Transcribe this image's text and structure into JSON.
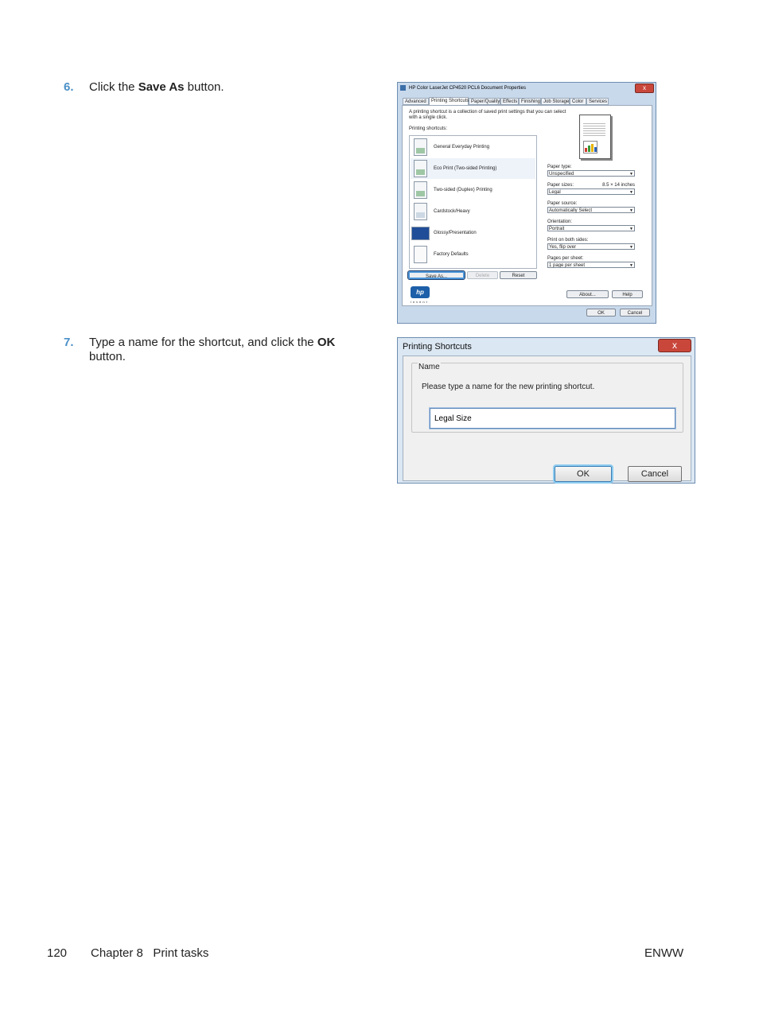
{
  "steps": [
    {
      "num": "6.",
      "pre": "Click the ",
      "bold": "Save As",
      "post": " button.",
      "line2": ""
    },
    {
      "num": "7.",
      "pre": "Type a name for the shortcut, and click the ",
      "bold": "OK",
      "post": "",
      "line2": "button."
    }
  ],
  "dialog1": {
    "title": "HP Color LaserJet CP4520 PCL6 Document Properties",
    "close": "x",
    "tabs": [
      "Advanced",
      "Printing Shortcuts",
      "Paper/Quality",
      "Effects",
      "Finishing",
      "Job Storage",
      "Color",
      "Services"
    ],
    "active_tab": "Printing Shortcuts",
    "description": "A printing shortcut is a collection of saved print settings that you can select with a single click.",
    "shortcuts_label": "Printing shortcuts:",
    "shortcuts": [
      "General Everyday Printing",
      "Eco Print (Two-sided Printing)",
      "Two-sided (Duplex) Printing",
      "Cardstock/Heavy",
      "Glossy/Presentation",
      "Factory Defaults"
    ],
    "selected_shortcut": "Eco Print (Two-sided Printing)",
    "buttons": {
      "save_as": "Save As...",
      "delete": "Delete",
      "reset": "Reset",
      "about": "About...",
      "help": "Help",
      "ok": "OK",
      "cancel": "Cancel"
    },
    "fields": {
      "paper_type_label": "Paper type:",
      "paper_type": "Unspecified",
      "paper_sizes_label": "Paper sizes:",
      "paper_sizes_dim": "8.5 × 14 inches",
      "paper_size": "Legal",
      "paper_source_label": "Paper source:",
      "paper_source": "Automatically Select",
      "orientation_label": "Orientation:",
      "orientation": "Portrait",
      "both_sides_label": "Print on both sides:",
      "both_sides": "Yes, flip over",
      "pages_per_sheet_label": "Pages per sheet:",
      "pages_per_sheet": "1 page per sheet"
    },
    "logo_text": "hp",
    "logo_tagline": "invent",
    "chart_colors": [
      "#d23c2c",
      "#3a9a3a",
      "#e8b400",
      "#2a62b8"
    ]
  },
  "dialog2": {
    "title": "Printing Shortcuts",
    "close": "x",
    "group_label": "Name",
    "prompt": "Please type a name for the new printing shortcut.",
    "input_value": "Legal Size",
    "ok": "OK",
    "cancel": "Cancel"
  },
  "footer": {
    "page_number": "120",
    "chapter": "Chapter 8   Print tasks",
    "right": "ENWW"
  }
}
